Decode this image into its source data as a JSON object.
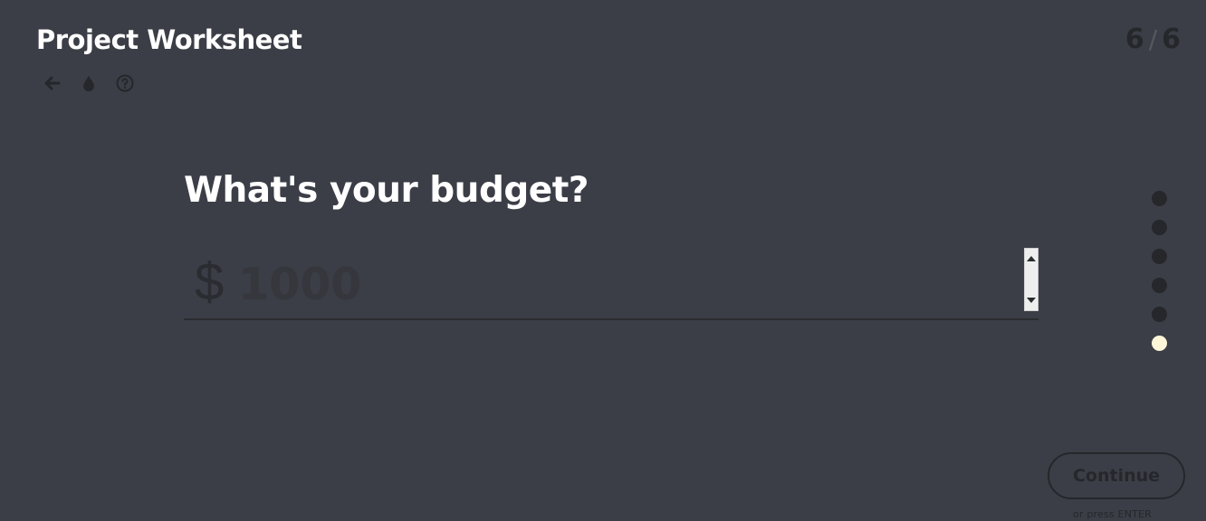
{
  "header": {
    "title": "Project Worksheet",
    "step_current": "6",
    "step_separator": "/",
    "step_total": "6"
  },
  "toolbar": {
    "icons": [
      "back-arrow-icon",
      "theme-drop-icon",
      "help-icon"
    ]
  },
  "question": {
    "text": "What's your budget?",
    "currency_symbol": "$",
    "input_value": "",
    "input_placeholder": "1000"
  },
  "progress": {
    "total": 6,
    "active_index": 5,
    "colors": {
      "inactive": "#25272b",
      "active": "#fdf6d7"
    }
  },
  "actions": {
    "continue_label": "Continue",
    "enter_hint": "or press ENTER"
  },
  "colors": {
    "background": "#3c3e47",
    "title": "#ffffff",
    "muted": "#25272b"
  }
}
